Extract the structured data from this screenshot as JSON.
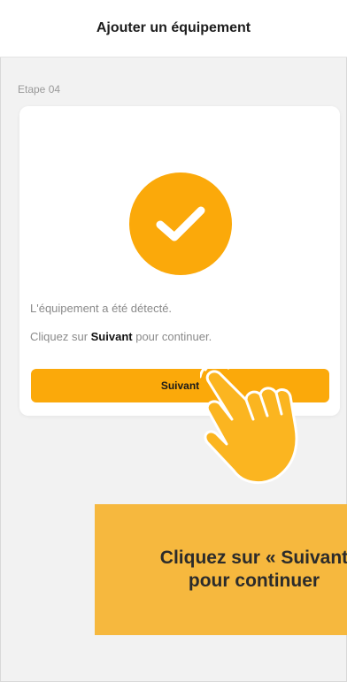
{
  "header": {
    "title": "Ajouter un équipement"
  },
  "step": {
    "label": "Etape 04"
  },
  "card": {
    "status_text": "L'équipement a été détecté.",
    "instruction_prefix": "Cliquez sur ",
    "instruction_bold": "Suivant",
    "instruction_suffix": " pour continuer.",
    "next_button_label": "Suivant",
    "status_icon": "check-icon"
  },
  "callout": {
    "line1": "Cliquez sur « Suivant",
    "line2": "pour continuer"
  },
  "colors": {
    "accent": "#fba90a",
    "callout_bg": "#f6b83e",
    "page_bg": "#f2f2f2"
  }
}
